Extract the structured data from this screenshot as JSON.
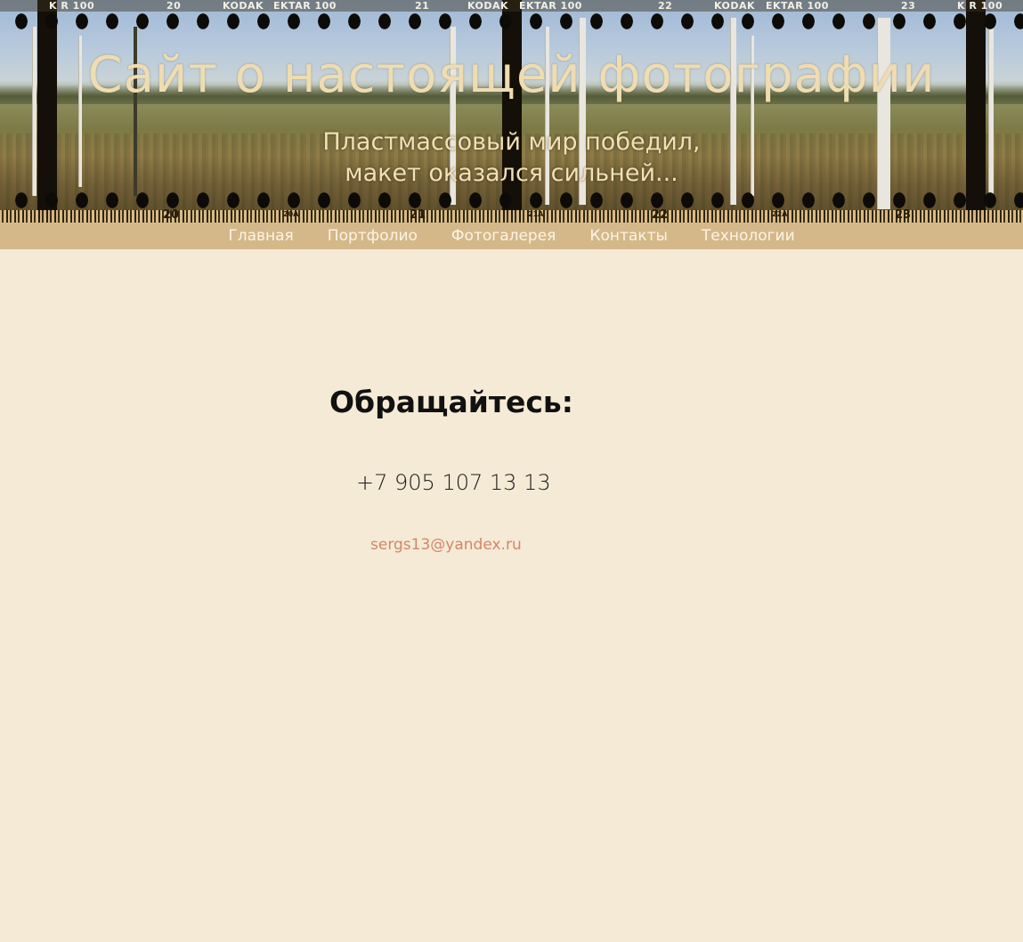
{
  "header": {
    "title": "Сайт о настоящей фотографии",
    "subtitle_line1": "Пластмассовый мир победил,",
    "subtitle_line2": "макет оказался сильней..."
  },
  "film_edge": {
    "top_labels": [
      "K R 100",
      "20",
      "KODAK",
      "EKTAR 100",
      "21",
      "KODAK",
      "EKTAR 100",
      "22",
      "KODAK",
      "EKTAR 100",
      "23",
      "K R 100"
    ],
    "bottom_numbers": [
      "20",
      "20A",
      "21",
      "21A",
      "22",
      "22A",
      "23"
    ]
  },
  "nav": {
    "items": [
      {
        "label": "Главная"
      },
      {
        "label": "Портфолио"
      },
      {
        "label": "Фотогалерея"
      },
      {
        "label": "Контакты"
      },
      {
        "label": "Технологии"
      }
    ]
  },
  "contacts": {
    "heading": "Обращайтесь:",
    "phone": "+7 905 107 13 13",
    "email": "sergs13@yandex.ru"
  },
  "colors": {
    "page_background": "#f5ead6",
    "nav_background": "#d5b889",
    "nav_text": "#fbf4e6",
    "title_text": "#efdcb0",
    "email_link": "#d1876a"
  }
}
